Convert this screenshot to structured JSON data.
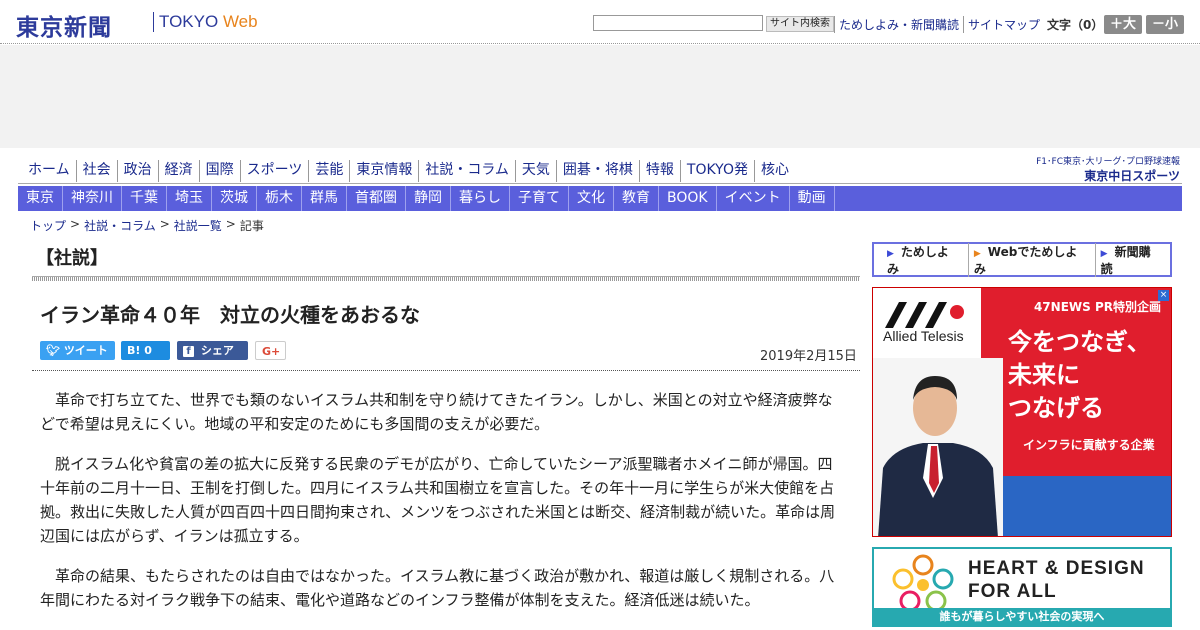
{
  "header": {
    "logo_main": "東京新聞",
    "logo_tokyo": "TOKYO",
    "logo_web": "Web",
    "search_button": "サイト内検索",
    "links": [
      "ためしよみ・新聞購読",
      "サイトマップ"
    ],
    "font_size_label": "文字（0）",
    "font_larger": "＋大",
    "font_smaller": "－小"
  },
  "nav1": [
    "ホーム",
    "社会",
    "政治",
    "経済",
    "国際",
    "スポーツ",
    "芸能",
    "東京情報",
    "社説・コラム",
    "天気",
    "囲碁・将棋",
    "特報",
    "TOKYO発",
    "核心"
  ],
  "nav2": [
    "東京",
    "神奈川",
    "千葉",
    "埼玉",
    "茨城",
    "栃木",
    "群馬",
    "首都圏",
    "静岡",
    "暮らし",
    "子育て",
    "文化",
    "教育",
    "BOOK",
    "イベント",
    "動画"
  ],
  "chunichi": {
    "small": "F1･FC東京･大リーグ･プロ野球速報",
    "big": "東京中日スポーツ"
  },
  "breadcrumb": [
    "トップ",
    "社説・コラム",
    "社説一覧",
    "記事"
  ],
  "article": {
    "section": "【社説】",
    "headline": "イラン革命４０年　対立の火種をあおるな",
    "date": "2019年2月15日",
    "share": {
      "tweet": "ツイート",
      "hatena": "B!  0",
      "facebook": "シェア 0",
      "gplus": "G+"
    },
    "paragraphs": [
      "革命で打ち立てた、世界でも類のないイスラム共和制を守り続けてきたイラン。しかし、米国との対立や経済疲弊などで希望は見えにくい。地域の平和安定のためにも多国間の支えが必要だ。",
      "脱イスラム化や貧富の差の拡大に反発する民衆のデモが広がり、亡命していたシーア派聖職者ホメイニ師が帰国。四十年前の二月十一日、王制を打倒した。四月にイスラム共和国樹立を宣言した。その年十一月に学生らが米大使館を占拠。救出に失敗した人質が四百四十四日間拘束され、メンツをつぶされた米国とは断交、経済制裁が続いた。革命は周辺国には広がらず、イランは孤立する。",
      "革命の結果、もたらされたのは自由ではなかった。イスラム教に基づく政治が敷かれ、報道は厳しく規制される。八年間にわたる対イラク戦争下の結束、電化や道路などのインフラ整備が体制を支えた。経済低迷は続いた。"
    ]
  },
  "sidebar": {
    "links": [
      "ためしよみ",
      "Webでためしよみ",
      "新聞購読"
    ],
    "ad": {
      "brand": "Allied Telesis",
      "tag": "47NEWS PR特別企画",
      "copy": [
        "今をつなぎ、",
        "未来に",
        "つなげる"
      ],
      "sub": "インフラに貢献する企業"
    },
    "heart": {
      "title_lines": [
        "HEART & DESIGN",
        "FOR ALL"
      ],
      "bar": "誰もが暮らしやすい社会の実現へ"
    }
  }
}
